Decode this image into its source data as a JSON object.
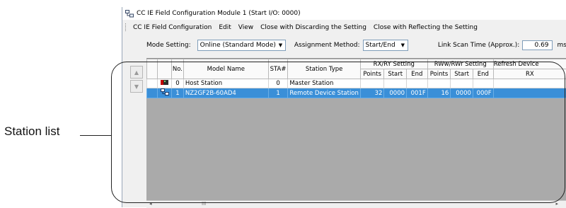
{
  "callout": {
    "label": "Station list"
  },
  "window": {
    "title": "CC IE Field Configuration Module 1 (Start I/O: 0000)"
  },
  "menu": [
    "CC IE Field Configuration",
    "Edit",
    "View",
    "Close with Discarding the Setting",
    "Close with Reflecting the Setting"
  ],
  "modebar": {
    "mode_label": "Mode Setting:",
    "mode_value": "Online (Standard Mode)",
    "assign_label": "Assignment Method:",
    "assign_value": "Start/End",
    "scan_label": "Link Scan Time (Approx.):",
    "scan_value": "0.69",
    "scan_unit": "ms"
  },
  "table": {
    "headers": {
      "no": "No.",
      "model": "Model Name",
      "sta": "STA#",
      "type": "Station Type",
      "rxry": "RX/RY Setting",
      "rwwrwr": "RWw/RWr Setting",
      "refresh": "Refresh Device",
      "points": "Points",
      "start": "Start",
      "end": "End",
      "rx": "RX"
    },
    "rows": [
      {
        "no": "0",
        "model": "Host Station",
        "sta": "0",
        "type": "Master Station",
        "rx_points": "",
        "rx_start": "",
        "rx_end": "",
        "rw_points": "",
        "rw_start": "",
        "rw_end": "",
        "ref_rx": "",
        "icon": "master-station-icon"
      },
      {
        "no": "1",
        "model": "NZ2GF2B-60AD4",
        "sta": "1",
        "type": "Remote Device Station",
        "rx_points": "32",
        "rx_start": "0000",
        "rx_end": "001F",
        "rw_points": "16",
        "rw_start": "0000",
        "rw_end": "000F",
        "ref_rx": "",
        "icon": "remote-device-icon"
      }
    ]
  },
  "scroll": {
    "grip": "III"
  },
  "colors": {
    "selected_row": "#3a8fd8",
    "empty_area": "#aaaaaa"
  }
}
